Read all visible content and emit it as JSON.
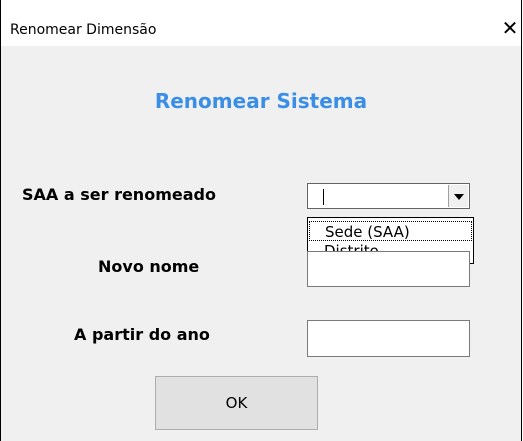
{
  "window": {
    "title": "Renomear Dimensão",
    "close_glyph": "✕"
  },
  "heading": "Renomear Sistema",
  "fields": {
    "saa_label": "SAA a ser renomeado",
    "novo_nome_label": "Novo nome",
    "ano_label": "A partir do ano"
  },
  "combo": {
    "value": "",
    "options": [
      "Sede (SAA)",
      "Distrito"
    ],
    "highlighted": "Sede (SAA)"
  },
  "novo_nome_value": "",
  "ano_value": "",
  "ok_label": "OK",
  "colors": {
    "heading": "#3a8ee6",
    "dialog_bg": "#f0f0f0"
  }
}
